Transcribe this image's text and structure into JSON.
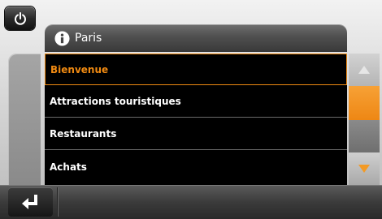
{
  "header": {
    "title": "Paris",
    "icon": "info-icon"
  },
  "menu": {
    "items": [
      {
        "label": "Bienvenue",
        "selected": true
      },
      {
        "label": "Attractions touristiques",
        "selected": false
      },
      {
        "label": "Restaurants",
        "selected": false
      },
      {
        "label": "Achats",
        "selected": false
      }
    ]
  },
  "colors": {
    "accent": "#f08a12",
    "list_bg": "#000000",
    "text": "#ffffff"
  },
  "icons": {
    "power": "power-icon",
    "back": "return-arrow-icon",
    "up": "triangle-up-icon",
    "down": "triangle-down-icon"
  }
}
